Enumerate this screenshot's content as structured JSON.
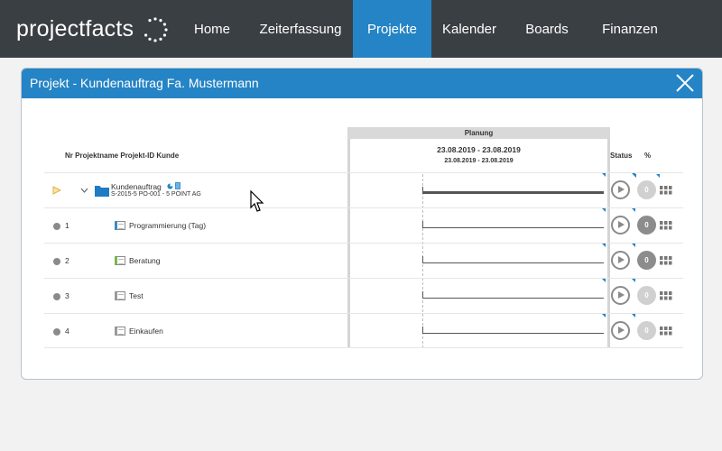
{
  "app": {
    "logo_text": "projectfacts"
  },
  "nav": {
    "items": [
      {
        "label": "Home"
      },
      {
        "label": "Zeiterfassung"
      },
      {
        "label": "Projekte",
        "active": true
      },
      {
        "label": "Kalender"
      },
      {
        "label": "Boards"
      },
      {
        "label": "Finanzen"
      }
    ]
  },
  "dialog": {
    "title": "Projekt - Kundenauftrag Fa. Mustermann",
    "close_icon": "close-icon"
  },
  "grid": {
    "header_left": "Nr Projektname Projekt-ID Kunde",
    "planning_caption": "Planung",
    "planning_range": "23.08.2019 - 23.08.2019",
    "planning_range_small": "23.08.2019 - 23.08.2019",
    "status_header": "Status",
    "percent_header": "%",
    "rows": [
      {
        "nr": "",
        "name": "Kundenauftrag",
        "sub": "S-2015-5 PO-001 - 5 POINT AG",
        "percent": "0",
        "icon": "folder-icon"
      },
      {
        "nr": "1",
        "name": "Programmierung (Tag)",
        "percent": "0",
        "icon": "task-icon"
      },
      {
        "nr": "2",
        "name": "Beratung",
        "percent": "0",
        "icon": "task-icon"
      },
      {
        "nr": "3",
        "name": "Test",
        "percent": "0",
        "icon": "task-icon"
      },
      {
        "nr": "4",
        "name": "Einkaufen",
        "percent": "0",
        "icon": "task-icon"
      }
    ]
  },
  "colors": {
    "accent": "#2584c5",
    "topbar": "#3a3f44"
  }
}
